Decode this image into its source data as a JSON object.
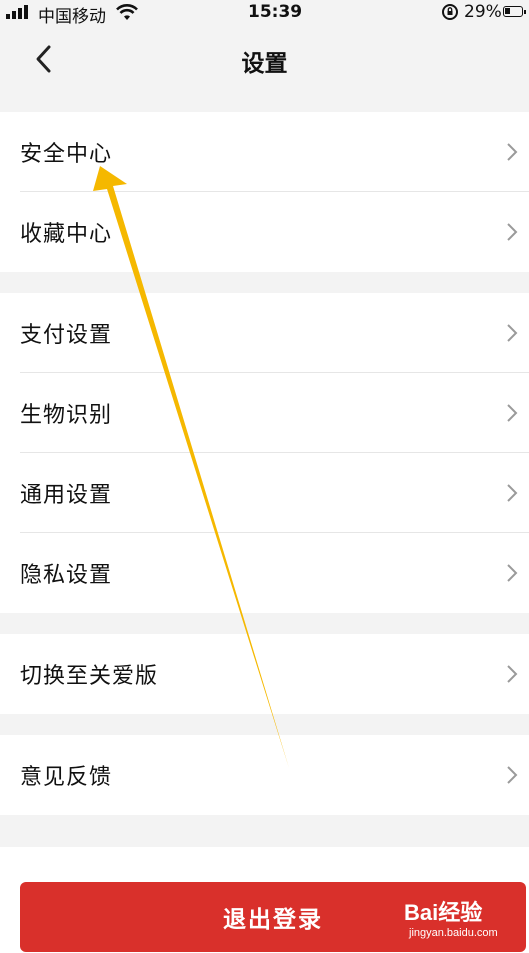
{
  "status_bar": {
    "carrier": "中国移动",
    "time": "15:39",
    "battery": "29%",
    "battery_level": 0.29,
    "icons": [
      "signal-icon",
      "wifi-icon",
      "rotation-lock-icon",
      "battery-icon"
    ]
  },
  "header": {
    "title": "设置",
    "back_icon": "chevron-left-icon"
  },
  "groups": [
    {
      "items": [
        {
          "label": "安全中心"
        },
        {
          "label": "收藏中心"
        }
      ]
    },
    {
      "items": [
        {
          "label": "支付设置"
        },
        {
          "label": "生物识别"
        },
        {
          "label": "通用设置"
        },
        {
          "label": "隐私设置"
        }
      ]
    },
    {
      "items": [
        {
          "label": "切换至关爱版"
        }
      ]
    },
    {
      "items": [
        {
          "label": "意见反馈"
        }
      ]
    }
  ],
  "logout_label": "退出登录",
  "annotation_color": "#f5b800",
  "watermark": {
    "brand": "Bai经验",
    "url": "jingyan.baidu.com"
  },
  "colors": {
    "logout": "#d9302b",
    "background": "#f3f3f3"
  }
}
